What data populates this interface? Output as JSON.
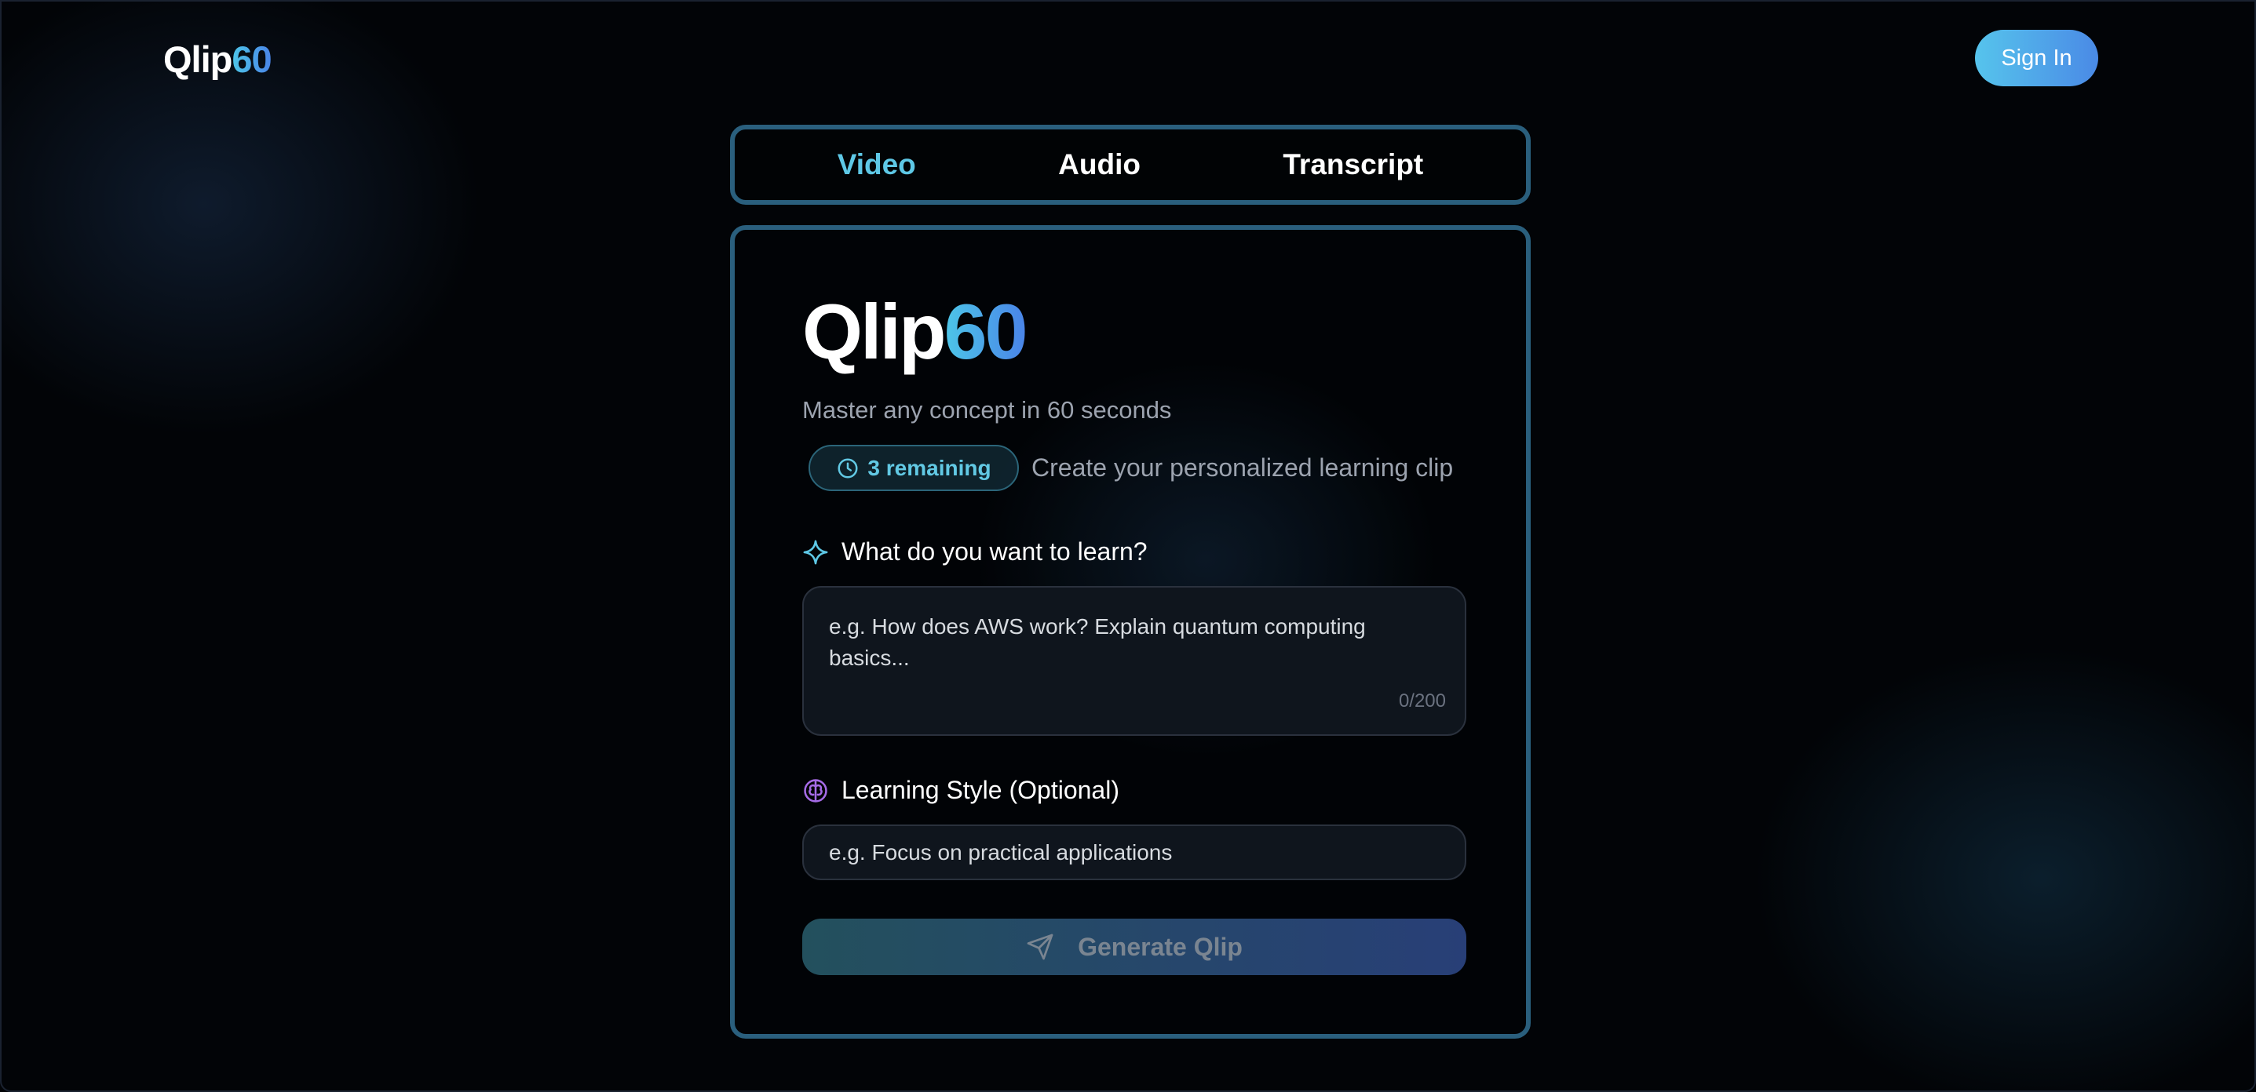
{
  "header": {
    "logo_text": "Qlip",
    "logo_accent": "60",
    "signin_label": "Sign In"
  },
  "tabs": [
    {
      "label": "Video",
      "active": true
    },
    {
      "label": "Audio",
      "active": false
    },
    {
      "label": "Transcript",
      "active": false
    }
  ],
  "card": {
    "title_text": "Qlip",
    "title_accent": "60",
    "subtitle": "Master any concept in 60 seconds",
    "badge_label": "3 remaining",
    "badge_caption": "Create your personalized learning clip",
    "topic": {
      "label": "What do you want to learn?",
      "placeholder": "e.g. How does AWS work? Explain quantum computing basics...",
      "counter": "0/200"
    },
    "style": {
      "label": "Learning Style (Optional)",
      "placeholder": "e.g. Focus on practical applications"
    },
    "generate_label": "Generate Qlip"
  },
  "icons": {
    "badge": "clock-icon",
    "topic": "sparkle-icon",
    "style": "brain-icon",
    "generate": "send-icon"
  },
  "colors": {
    "accent": "#5ec8e6",
    "border": "#2a5f7d",
    "style_icon": "#a56be6",
    "background": "#020407"
  }
}
